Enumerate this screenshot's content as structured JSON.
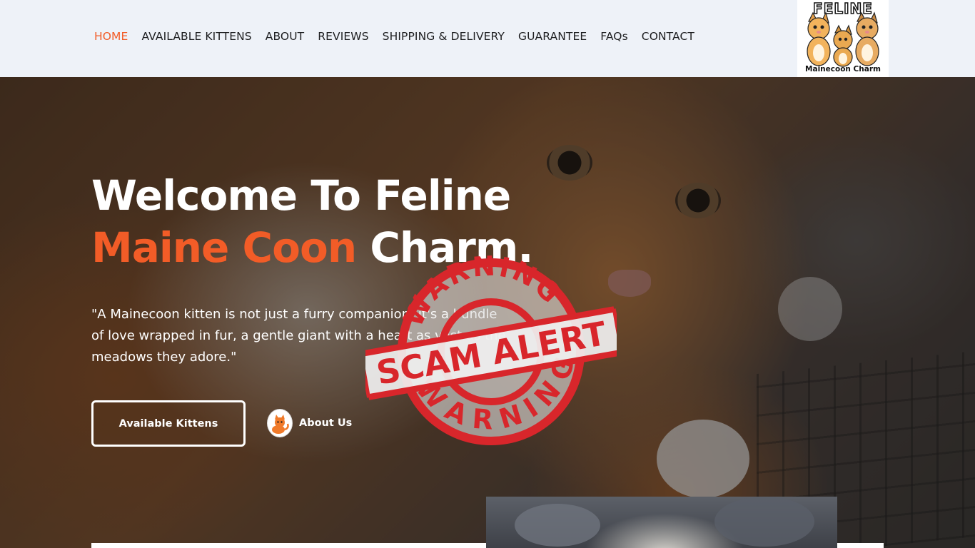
{
  "nav": {
    "items": [
      {
        "label": "HOME",
        "active": true
      },
      {
        "label": "AVAILABLE KITTENS",
        "active": false
      },
      {
        "label": "ABOUT",
        "active": false
      },
      {
        "label": "REVIEWS",
        "active": false
      },
      {
        "label": "SHIPPING & DELIVERY",
        "active": false
      },
      {
        "label": "GUARANTEE",
        "active": false
      },
      {
        "label": "FAQs",
        "active": false
      },
      {
        "label": "CONTACT",
        "active": false
      }
    ]
  },
  "logo": {
    "title": "FELINE",
    "subtitle": "Mainecoon Charm"
  },
  "hero": {
    "headline_line1": "Welcome To Feline",
    "headline_orange": "Maine Coon",
    "headline_white": "Charm.",
    "quote": "\"A Mainecoon kitten is not just a furry companion; it's a bundle of love wrapped in fur, a gentle giant with a heart as vast as the meadows they adore.\"",
    "primary_button": "Available Kittens",
    "secondary_link": "About Us"
  },
  "stamp": {
    "top_text": "WARNING",
    "center_text": "SCAM ALERT",
    "bottom_text": "WARNING",
    "color": "#d8262b"
  },
  "colors": {
    "accent": "#f25c27",
    "header_bg": "#eef2f8"
  }
}
